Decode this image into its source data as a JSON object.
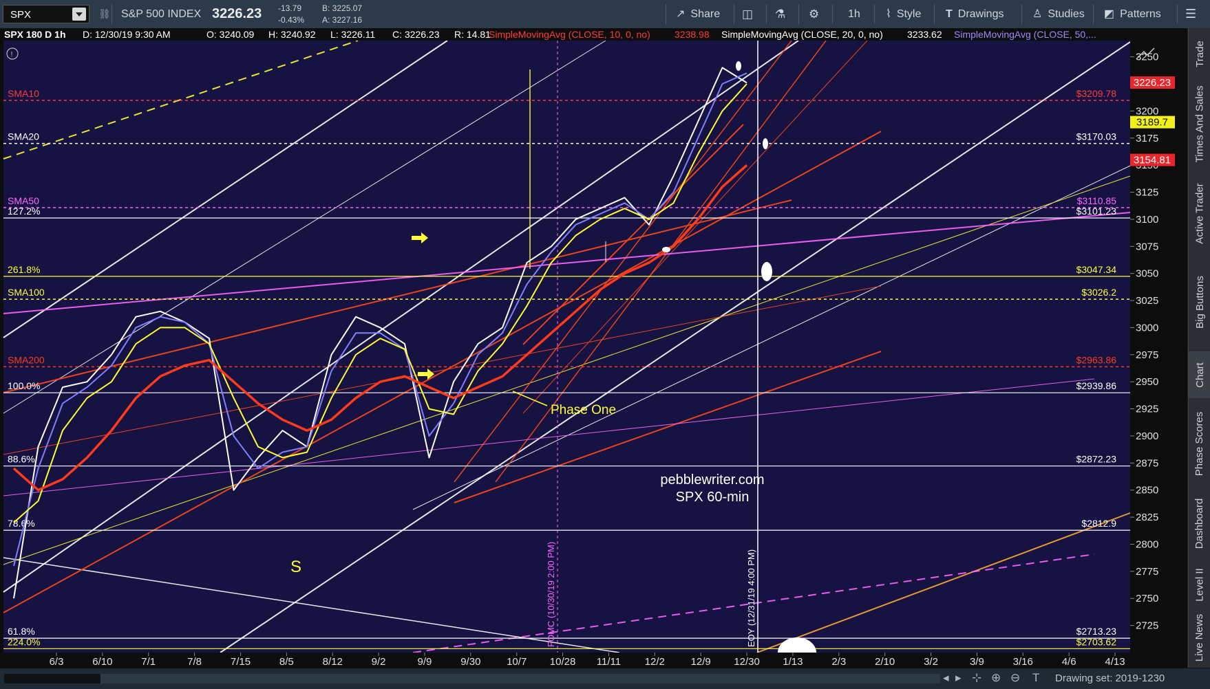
{
  "toolbar": {
    "symbol": "SPX",
    "index_name": "S&P 500 INDEX",
    "last": "3226.23",
    "change": "-13.79",
    "change_pct": "-0.43%",
    "bid": "B: 3225.07",
    "ask": "A: 3227.16",
    "share_label": "Share",
    "interval_label": "1h",
    "style_label": "Style",
    "drawings_label": "Drawings",
    "studies_label": "Studies",
    "patterns_label": "Patterns"
  },
  "header": {
    "chart_id": "SPX 180 D 1h",
    "date": "D: 12/30/19 9:30 AM",
    "open": "O: 3240.09",
    "high": "H: 3240.92",
    "low": "L: 3226.11",
    "close": "C: 3226.23",
    "range": "R: 14.81",
    "sma10": "SimpleMovingAvg (CLOSE, 10, 0, no)",
    "sma10_val": "3238.98",
    "sma20": "SimpleMovingAvg (CLOSE, 20, 0, no)",
    "sma20_val": "3233.62",
    "sma50": "SimpleMovingAvg (CLOSE, 50,..."
  },
  "right_tabs": [
    "Trade",
    "Times And Sales",
    "Active Trader",
    "Big Buttons",
    "Chart",
    "Phase Scores",
    "Dashboard",
    "Level II",
    "Live News"
  ],
  "bottom": {
    "drawing_set": "Drawing set: 2019-1230"
  },
  "colors": {
    "background": "#161242",
    "sma10": "#ff3b3b",
    "sma20": "#ffffff",
    "sma50": "#ff66ff",
    "sma100": "#ffff33",
    "sma200": "#ff3b1a",
    "fib": "#ffffff"
  },
  "chart_data": {
    "type": "line",
    "title": "",
    "annotations": [
      "pebblewriter.com",
      "SPX 60-min",
      "Phase One",
      "S",
      "FOMC (10/30/19 2:00 PM)",
      "EOY (12/31/19 4:00 PM)"
    ],
    "ylim": [
      2700,
      3265
    ],
    "yticks": [
      2725,
      2750,
      2775,
      2800,
      2825,
      2850,
      2875,
      2900,
      2925,
      2950,
      2975,
      3000,
      3025,
      3050,
      3075,
      3100,
      3125,
      3150,
      3175,
      3200,
      3225,
      3250
    ],
    "x_ticks": [
      "6/3",
      "6/10",
      "7/1",
      "7/8",
      "7/15",
      "8/5",
      "8/12",
      "9/2",
      "9/9",
      "9/30",
      "10/7",
      "10/28",
      "11/11",
      "12/2",
      "12/9",
      "12/30",
      "1/13",
      "2/3",
      "2/10",
      "3/2",
      "3/9",
      "3/16",
      "4/6",
      "4/13"
    ],
    "price_markers": [
      {
        "label": "3226.23",
        "value": 3226.23,
        "color": "#e8262b"
      },
      {
        "label": "3189.7",
        "value": 3189.7,
        "color": "#f2f21a"
      },
      {
        "label": "3154.81",
        "value": 3154.81,
        "color": "#e8262b"
      }
    ],
    "levels": [
      {
        "name": "SMA10",
        "value": 3209.78,
        "label": "$3209.78",
        "color": "#ff3b3b",
        "style": "dashed"
      },
      {
        "name": "SMA20",
        "value": 3170.03,
        "label": "$3170.03",
        "color": "#ffffff",
        "style": "dashed"
      },
      {
        "name": "SMA50",
        "value": 3110.85,
        "label": "$3110.85",
        "color": "#ff66ff",
        "style": "dashed"
      },
      {
        "name": "127.2%",
        "value": 3101.23,
        "label": "$3101.23",
        "color": "#ffffff",
        "style": "solid"
      },
      {
        "name": "261.8%",
        "value": 3047.34,
        "label": "$3047.34",
        "color": "#ffff33",
        "style": "solid"
      },
      {
        "name": "SMA100",
        "value": 3026.2,
        "label": "$3026.2",
        "color": "#ffff33",
        "style": "dashed"
      },
      {
        "name": "SMA200",
        "value": 2963.86,
        "label": "$2963.86",
        "color": "#ff3b1a",
        "style": "dashed"
      },
      {
        "name": "100.0%",
        "value": 2939.86,
        "label": "$2939.86",
        "color": "#ffffff",
        "style": "solid"
      },
      {
        "name": "88.6%",
        "value": 2872.23,
        "label": "$2872.23",
        "color": "#ffffff",
        "style": "solid"
      },
      {
        "name": "78.6%",
        "value": 2812.9,
        "label": "$2812.9",
        "color": "#ffffff",
        "style": "solid"
      },
      {
        "name": "61.8%",
        "value": 2713.23,
        "label": "$2713.23",
        "color": "#ffffff",
        "style": "solid"
      },
      {
        "name": "224.0%",
        "value": 2703.62,
        "label": "$2703.62",
        "color": "#ffff33",
        "style": "solid"
      }
    ],
    "series": [
      {
        "name": "SPX",
        "color": "#ffffff",
        "x": [
          "6/3",
          "6/10",
          "6/17",
          "6/24",
          "7/1",
          "7/8",
          "7/15",
          "7/22",
          "7/29",
          "8/5",
          "8/12",
          "8/19",
          "8/26",
          "9/2",
          "9/9",
          "9/16",
          "9/23",
          "9/30",
          "10/7",
          "10/14",
          "10/21",
          "10/28",
          "11/4",
          "11/11",
          "11/18",
          "11/25",
          "12/2",
          "12/9",
          "12/16",
          "12/23",
          "12/30"
        ],
        "values": [
          2750,
          2890,
          2945,
          2950,
          2975,
          3010,
          3015,
          3005,
          2990,
          2850,
          2880,
          2905,
          2890,
          2975,
          3010,
          3000,
          2985,
          2880,
          2950,
          2985,
          3000,
          3060,
          3075,
          3100,
          3110,
          3120,
          3095,
          3140,
          3190,
          3240,
          3226
        ]
      },
      {
        "name": "SMA10",
        "color": "#8080ff",
        "values": [
          2780,
          2870,
          2930,
          2945,
          2965,
          3000,
          3010,
          3005,
          2985,
          2900,
          2870,
          2885,
          2890,
          2960,
          2995,
          2995,
          2980,
          2900,
          2930,
          2975,
          2995,
          3040,
          3070,
          3095,
          3105,
          3115,
          3100,
          3125,
          3175,
          3225,
          3235
        ]
      },
      {
        "name": "SMA20",
        "color": "#ffff33",
        "values": [
          2820,
          2840,
          2905,
          2935,
          2950,
          2985,
          3000,
          3000,
          2985,
          2935,
          2890,
          2880,
          2885,
          2935,
          2975,
          2990,
          2980,
          2925,
          2920,
          2960,
          2985,
          3020,
          3060,
          3085,
          3100,
          3110,
          3100,
          3115,
          3160,
          3200,
          3225
        ]
      },
      {
        "name": "SMA50",
        "color": "#ff3b1a",
        "values": [
          2870,
          2850,
          2860,
          2880,
          2905,
          2935,
          2955,
          2965,
          2970,
          2950,
          2930,
          2915,
          2905,
          2915,
          2935,
          2950,
          2955,
          2945,
          2935,
          2945,
          2955,
          2975,
          2995,
          3015,
          3035,
          3050,
          3060,
          3075,
          3100,
          3130,
          3150
        ]
      }
    ]
  }
}
